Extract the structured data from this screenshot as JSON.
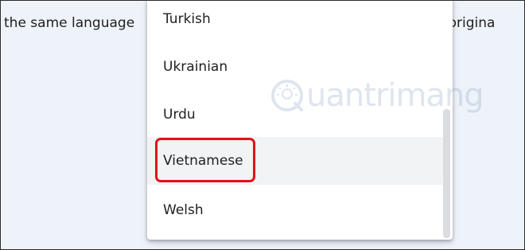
{
  "background_text": {
    "left": "the same language",
    "right": "he origina"
  },
  "dropdown": {
    "options": [
      {
        "label": "Turkish"
      },
      {
        "label": "Ukrainian"
      },
      {
        "label": "Urdu"
      },
      {
        "label": "Vietnamese"
      },
      {
        "label": "Welsh"
      }
    ],
    "hovered_option": "Vietnamese",
    "highlight_color": "#e2121b"
  },
  "watermark": {
    "text": "uantrimang",
    "icon": "quantrimang-logo-icon"
  }
}
